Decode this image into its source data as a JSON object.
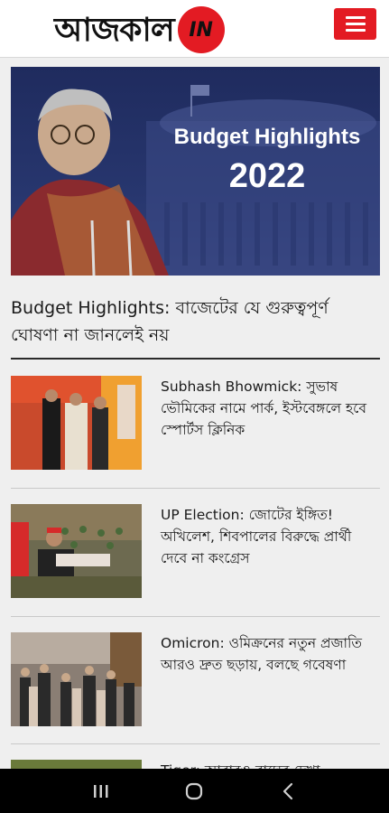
{
  "header": {
    "logo_text": "আজকাল",
    "logo_suffix": "IN",
    "menu_icon": "hamburger-menu-icon",
    "brand_color": "#e31b23"
  },
  "hero": {
    "image_title_line1": "Budget Highlights",
    "image_title_line2": "2022",
    "headline": "Budget Highlights: বাজেটের যে গুরুত্বপূর্ণ ঘোষণা না জানলেই নয়"
  },
  "articles": [
    {
      "title": "Subhash Bhowmick: সুভাষ ভৌমিকের নামে পার্ক, ইস্টবেঙ্গলে হবে স্পোর্টস ক্লিনিক"
    },
    {
      "title": "UP Election: জোটের ইঙ্গিত! অখিলেশ, শিবপালের বিরুদ্ধে প্রার্থী দেবে না কংগ্রেস"
    },
    {
      "title": "Omicron: ওমিক্রনের নতুন প্রজাতি আরও দ্রুত ছড়ায়, বলছে গবেষণা"
    },
    {
      "title": "Tiger: আবারও বাঘের দেখা"
    }
  ],
  "navbar": {
    "recent_icon": "recent-apps-icon",
    "home_icon": "home-circle-icon",
    "back_icon": "back-chevron-icon"
  }
}
